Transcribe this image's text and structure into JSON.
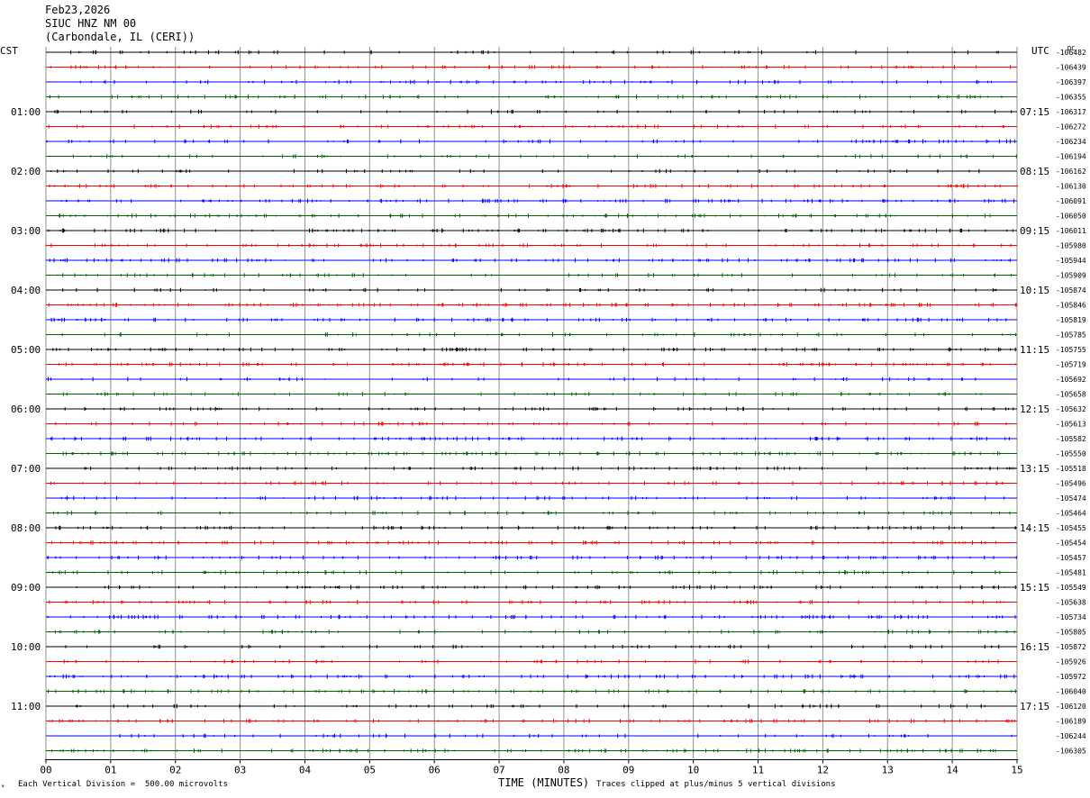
{
  "header": {
    "date": "Feb23,2026",
    "station": "SIUC HNZ NM 00",
    "location": "(Carbondale, IL (CERI))"
  },
  "chart_data": {
    "type": "line",
    "left_timezone": "CST",
    "right_timezone": "UTC",
    "dc_label": "DC",
    "x_axis_label": "TIME (MINUTES)",
    "x_tick_labels": [
      "00",
      "01",
      "02",
      "03",
      "04",
      "05",
      "06",
      "07",
      "08",
      "09",
      "10",
      "11",
      "12",
      "13",
      "14",
      "15"
    ],
    "xlim": [
      0,
      15
    ],
    "left_hour_labels": [
      "01:00",
      "02:00",
      "03:00",
      "04:00",
      "05:00",
      "06:00",
      "07:00",
      "08:00",
      "09:00",
      "10:00",
      "11:00"
    ],
    "right_hour_labels": [
      "07:15",
      "08:15",
      "09:15",
      "10:15",
      "11:15",
      "12:15",
      "13:15",
      "14:15",
      "15:15",
      "16:15",
      "17:15"
    ],
    "trace_colors": [
      "#000000",
      "#ff0000",
      "#0000ff",
      "#006600"
    ],
    "dc_offsets": [
      "-106482",
      "-106439",
      "-106397",
      "-106355",
      "-106317",
      "-106272",
      "-106234",
      "-106194",
      "-106162",
      "-106130",
      "-106091",
      "-106050",
      "-106011",
      "-105980",
      "-105944",
      "-105909",
      "-105874",
      "-105846",
      "-105819",
      "-105785",
      "-105755",
      "-105719",
      "-105692",
      "-105658",
      "-105632",
      "-105613",
      "-105582",
      "-105550",
      "-105518",
      "-105496",
      "-105474",
      "-105464",
      "-105455",
      "-105454",
      "-105457",
      "-105481",
      "-105549",
      "-105638",
      "-105734",
      "-105805",
      "-105872",
      "-105926",
      "-105972",
      "-106040",
      "-106120",
      "-106189",
      "-106244",
      "-106305"
    ],
    "scale_note": "Each Vertical Division =  500.00 microvolts",
    "clip_note": "Traces clipped at plus/minus 5 vertical divisions",
    "corner_mark": "*"
  }
}
